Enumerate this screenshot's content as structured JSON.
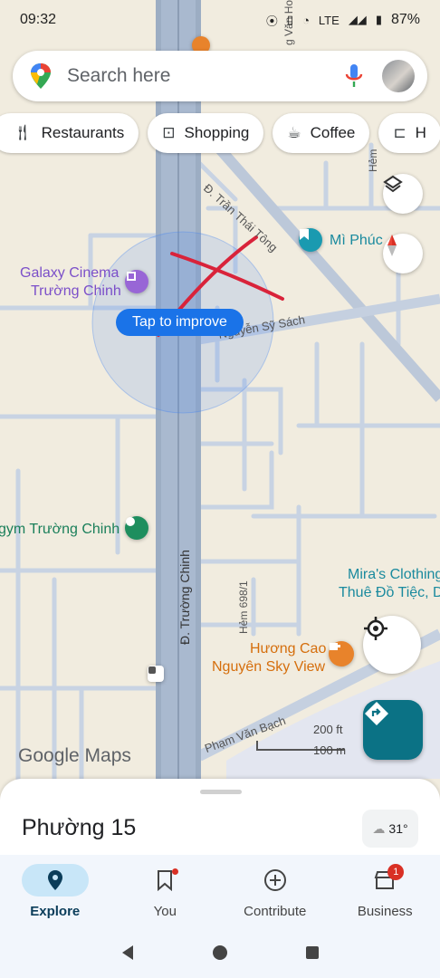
{
  "status_bar": {
    "time": "09:32",
    "network": "LTE",
    "battery": "87%"
  },
  "search": {
    "placeholder": "Search here"
  },
  "chips": [
    {
      "label": "Restaurants",
      "icon": "fork-knife-icon"
    },
    {
      "label": "Shopping",
      "icon": "shopping-bag-icon"
    },
    {
      "label": "Coffee",
      "icon": "coffee-cup-icon"
    },
    {
      "label": "H",
      "icon": "bed-icon"
    }
  ],
  "map": {
    "places": {
      "galaxy_line1": "Galaxy Cinema",
      "galaxy_line2": "Trường Chinh",
      "gym": "gym Trường Chinh",
      "mi_phuc": "Mì Phúc",
      "miras_line1": "Mira's Clothing",
      "miras_line2": "Thuê Đồ Tiệc, D",
      "huong_cao_line1": "Hương Cao",
      "huong_cao_line2": "Nguyên Sky View"
    },
    "streets": {
      "tran_thai_tong": "Đ. Trần Thái Tông",
      "nguyen_sy_sach": "Nguyễn Sỹ Sách",
      "truong_chinh": "Đ. Trường Chinh",
      "hem_698": "Hẻm 698/1",
      "pham_van_bach": "Phạm Văn Bạch",
      "hoang_van": "g Văn Hoà",
      "hem_top": "Hẻm"
    },
    "tap_to_improve": "Tap to improve",
    "google_logo": "Google Maps",
    "scale_ft": "200 ft",
    "scale_m": "100 m"
  },
  "sheet": {
    "place_name": "Phường 15",
    "temperature": "31°"
  },
  "nav": {
    "items": [
      {
        "label": "Explore",
        "icon": "explore-pin-icon",
        "active": true
      },
      {
        "label": "You",
        "icon": "bookmark-icon"
      },
      {
        "label": "Contribute",
        "icon": "add-circle-icon"
      },
      {
        "label": "Business",
        "icon": "store-icon",
        "badge": "1"
      }
    ]
  },
  "colors": {
    "accent_blue": "#1a73e8",
    "directions_teal": "#0b7285",
    "annotation_red": "#d9233a",
    "map_bg": "#f1ecdf",
    "main_road": "#9aaabf"
  }
}
